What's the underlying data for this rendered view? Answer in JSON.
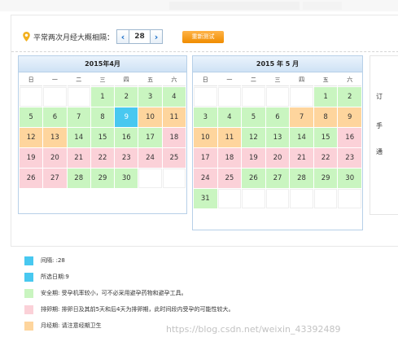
{
  "setting": {
    "label": "平常两次月经大概相隔：",
    "prev": "‹",
    "value": "28",
    "next": "›",
    "recalc_button": "重新测试"
  },
  "calendars": [
    {
      "title": "2015年4月",
      "weekdays": [
        "日",
        "一",
        "二",
        "三",
        "四",
        "五",
        "六"
      ],
      "days": [
        {
          "d": "",
          "s": "empty"
        },
        {
          "d": "",
          "s": "empty"
        },
        {
          "d": "",
          "s": "empty"
        },
        {
          "d": "1",
          "s": "safe"
        },
        {
          "d": "2",
          "s": "safe"
        },
        {
          "d": "3",
          "s": "safe"
        },
        {
          "d": "4",
          "s": "safe"
        },
        {
          "d": "5",
          "s": "safe"
        },
        {
          "d": "6",
          "s": "safe"
        },
        {
          "d": "7",
          "s": "safe"
        },
        {
          "d": "8",
          "s": "safe"
        },
        {
          "d": "9",
          "s": "sel"
        },
        {
          "d": "10",
          "s": "period"
        },
        {
          "d": "11",
          "s": "period"
        },
        {
          "d": "12",
          "s": "period"
        },
        {
          "d": "13",
          "s": "period"
        },
        {
          "d": "14",
          "s": "safe"
        },
        {
          "d": "15",
          "s": "safe"
        },
        {
          "d": "16",
          "s": "safe"
        },
        {
          "d": "17",
          "s": "safe"
        },
        {
          "d": "18",
          "s": "ovul"
        },
        {
          "d": "19",
          "s": "ovul"
        },
        {
          "d": "20",
          "s": "ovul"
        },
        {
          "d": "21",
          "s": "ovul"
        },
        {
          "d": "22",
          "s": "ovul"
        },
        {
          "d": "23",
          "s": "ovul"
        },
        {
          "d": "24",
          "s": "ovul"
        },
        {
          "d": "25",
          "s": "ovul"
        },
        {
          "d": "26",
          "s": "ovul"
        },
        {
          "d": "27",
          "s": "ovul"
        },
        {
          "d": "28",
          "s": "safe"
        },
        {
          "d": "29",
          "s": "safe"
        },
        {
          "d": "30",
          "s": "safe"
        },
        {
          "d": "",
          "s": "empty"
        },
        {
          "d": "",
          "s": "empty"
        }
      ]
    },
    {
      "title": "2015 年 5 月",
      "weekdays": [
        "日",
        "一",
        "二",
        "三",
        "四",
        "五",
        "六"
      ],
      "days": [
        {
          "d": "",
          "s": "empty"
        },
        {
          "d": "",
          "s": "empty"
        },
        {
          "d": "",
          "s": "empty"
        },
        {
          "d": "",
          "s": "empty"
        },
        {
          "d": "",
          "s": "empty"
        },
        {
          "d": "1",
          "s": "safe"
        },
        {
          "d": "2",
          "s": "safe"
        },
        {
          "d": "3",
          "s": "safe"
        },
        {
          "d": "4",
          "s": "safe"
        },
        {
          "d": "5",
          "s": "safe"
        },
        {
          "d": "6",
          "s": "safe"
        },
        {
          "d": "7",
          "s": "period"
        },
        {
          "d": "8",
          "s": "period"
        },
        {
          "d": "9",
          "s": "period"
        },
        {
          "d": "10",
          "s": "period"
        },
        {
          "d": "11",
          "s": "period"
        },
        {
          "d": "12",
          "s": "safe"
        },
        {
          "d": "13",
          "s": "safe"
        },
        {
          "d": "14",
          "s": "safe"
        },
        {
          "d": "15",
          "s": "safe"
        },
        {
          "d": "16",
          "s": "ovul"
        },
        {
          "d": "17",
          "s": "ovul"
        },
        {
          "d": "18",
          "s": "ovul"
        },
        {
          "d": "19",
          "s": "ovul"
        },
        {
          "d": "20",
          "s": "ovul"
        },
        {
          "d": "21",
          "s": "ovul"
        },
        {
          "d": "22",
          "s": "ovul"
        },
        {
          "d": "23",
          "s": "ovul"
        },
        {
          "d": "24",
          "s": "ovul"
        },
        {
          "d": "25",
          "s": "ovul"
        },
        {
          "d": "26",
          "s": "safe"
        },
        {
          "d": "27",
          "s": "safe"
        },
        {
          "d": "28",
          "s": "safe"
        },
        {
          "d": "29",
          "s": "safe"
        },
        {
          "d": "30",
          "s": "safe"
        },
        {
          "d": "31",
          "s": "safe"
        },
        {
          "d": "",
          "s": "empty"
        },
        {
          "d": "",
          "s": "empty"
        },
        {
          "d": "",
          "s": "empty"
        },
        {
          "d": "",
          "s": "empty"
        },
        {
          "d": "",
          "s": "empty"
        },
        {
          "d": "",
          "s": "empty"
        }
      ]
    }
  ],
  "right_panel": {
    "line1": "订",
    "line2": "手",
    "line3": "通"
  },
  "legend": {
    "interval": "间隔: :28",
    "selected": "所选日期:9",
    "safe": "安全期: 受孕机率较小，可不必采用避孕药物和避孕工具。",
    "ovulation": "排卵期: 排卵日及其前5天和后4天为排卵期，此时间段内受孕的可能性较大。",
    "period": "月经期: 请注意经期卫生"
  },
  "watermark": "https://blog.csdn.net/weixin_43392489",
  "colors": {
    "safe": "#c9f5c0",
    "ovulation": "#fbd1d8",
    "period": "#fed59d",
    "selected": "#48c8f0",
    "button": "#f39a18"
  },
  "icons": [
    "location-pin-icon",
    "chevron-left-icon",
    "chevron-right-icon"
  ]
}
